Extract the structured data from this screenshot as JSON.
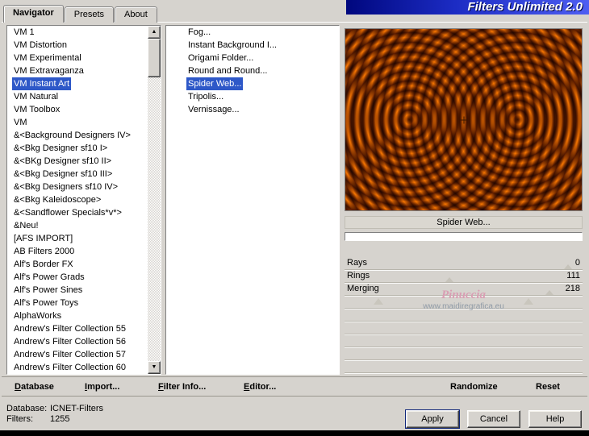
{
  "window": {
    "title": "Filters Unlimited 2.0"
  },
  "tabs": {
    "items": [
      "Navigator",
      "Presets",
      "About"
    ],
    "active_index": 0
  },
  "categories": {
    "items": [
      "VM 1",
      "VM Distortion",
      "VM Experimental",
      "VM Extravaganza",
      "VM Instant Art",
      "VM Natural",
      "VM Toolbox",
      "VM",
      "&<Background Designers IV>",
      "&<Bkg Designer sf10 I>",
      "&<BKg Designer sf10 II>",
      "&<Bkg Designer sf10 III>",
      "&<Bkg Designers sf10 IV>",
      "&<Bkg Kaleidoscope>",
      "&<Sandflower Specials*v*>",
      "&Neu!",
      "[AFS IMPORT]",
      "AB Filters 2000",
      "Alf's Border FX",
      "Alf's Power Grads",
      "Alf's Power Sines",
      "Alf's Power Toys",
      "AlphaWorks",
      "Andrew's Filter Collection 55",
      "Andrew's Filter Collection 56",
      "Andrew's Filter Collection 57",
      "Andrew's Filter Collection 60"
    ],
    "selected_index": 4
  },
  "filters": {
    "items": [
      "Fog...",
      "Instant Background I...",
      "Origami Folder...",
      "Round and Round...",
      "Spider Web...",
      "Tripolis...",
      "Vernissage..."
    ],
    "selected_index": 4
  },
  "preview": {
    "filter_name": "Spider Web...",
    "progress_pct": 0
  },
  "parameters": [
    {
      "name": "Rays",
      "value": 0,
      "thumb_pct": 94
    },
    {
      "name": "Rings",
      "value": 111,
      "thumb_pct": 44
    },
    {
      "name": "Merging",
      "value": 218,
      "thumb_pct": 86
    }
  ],
  "watermark": {
    "line1": "Pinuccia",
    "line2": "www.maidiregrafica.eu"
  },
  "toolbar": {
    "items": [
      {
        "key": "D",
        "rest": "atabase"
      },
      {
        "key": "I",
        "rest": "mport..."
      },
      {
        "key": "F",
        "rest": "ilter Info..."
      },
      {
        "key": "E",
        "rest": "ditor..."
      },
      {
        "key": "",
        "rest": "Randomize"
      },
      {
        "key": "",
        "rest": "Reset"
      }
    ]
  },
  "status": {
    "database_label": "Database:",
    "database_value": "ICNET-Filters",
    "filters_label": "Filters:",
    "filters_value": "1255"
  },
  "buttons": {
    "apply": "Apply",
    "cancel": "Cancel",
    "help": "Help"
  },
  "icons": {
    "scroll_up": "▲",
    "scroll_down": "▼"
  },
  "colors": {
    "selection_blue": "#2e58c8",
    "banner_start": "#00077e",
    "banner_end": "#4e5ef2",
    "preview_gold": "#ffc832",
    "preview_brown": "#5c2c00",
    "watermark_pink": "#d99eb3"
  }
}
